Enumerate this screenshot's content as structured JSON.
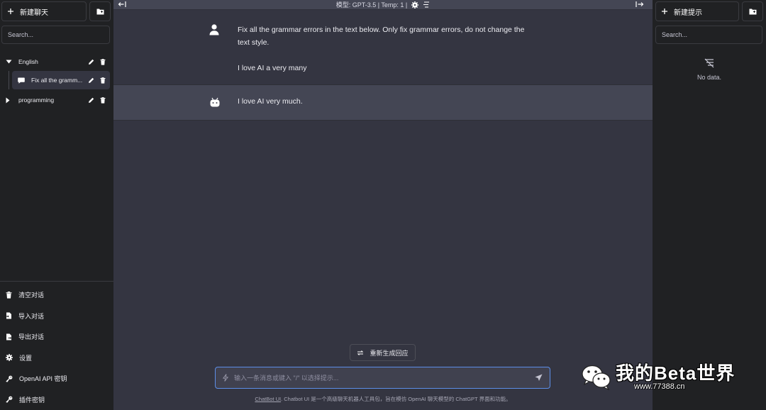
{
  "left_sidebar": {
    "new_chat_label": "新建聊天",
    "search_placeholder": "Search...",
    "folders": [
      {
        "name": "English",
        "expanded": true
      },
      {
        "name": "programming",
        "expanded": false
      }
    ],
    "conversations": [
      {
        "title": "Fix all the gramm..."
      }
    ],
    "bottom_items": [
      {
        "label": "清空对话",
        "icon": "trash-icon"
      },
      {
        "label": "导入对话",
        "icon": "file-import-icon"
      },
      {
        "label": "导出对话",
        "icon": "file-export-icon"
      },
      {
        "label": "设置",
        "icon": "gear-icon"
      },
      {
        "label": "OpenAI API 密钥",
        "icon": "key-icon"
      },
      {
        "label": "插件密钥",
        "icon": "key-icon"
      }
    ]
  },
  "topbar": {
    "model_text": "模型: GPT-3.5 | Temp: 1 |"
  },
  "messages": [
    {
      "role": "user",
      "lines": [
        "Fix all the grammar errors in the text below. Only fix grammar errors, do not change the text style.",
        "I love AI a very many"
      ]
    },
    {
      "role": "assistant",
      "lines": [
        "I love AI very much."
      ]
    }
  ],
  "regenerate_label": "重新生成回应",
  "input": {
    "placeholder": "输入一条消息或键入 \"/\" 以选择提示..."
  },
  "footer": {
    "link_text": "ChatBot UI",
    "text": ". Chatbot UI 是一个高级聊天机器人工具包，旨在模仿 OpenAI 聊天模型的 ChatGPT 界面和功能。"
  },
  "right_sidebar": {
    "new_prompt_label": "新建提示",
    "search_placeholder": "Search...",
    "empty_text": "No data."
  },
  "watermark": {
    "title": "我的Beta世界",
    "url": "www.77388.cn"
  },
  "colors": {
    "sidebar_bg": "#202123",
    "main_bg": "#343541",
    "assistant_bg": "#444654",
    "input_border": "#5c8ee8"
  }
}
